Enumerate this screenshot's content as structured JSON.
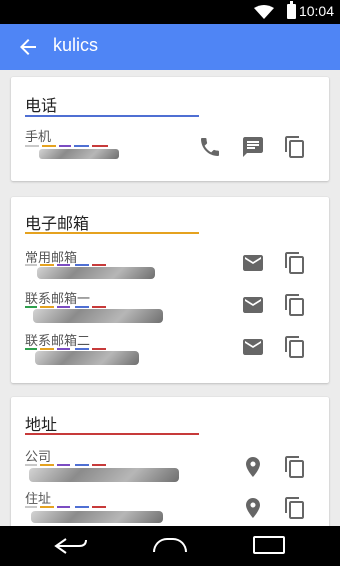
{
  "status_bar": {
    "time": "10:04"
  },
  "app_bar": {
    "title": "kulics",
    "back_icon": "arrow-back-icon"
  },
  "sections": {
    "phone": {
      "title": "电话",
      "underline_color": "#4f6fd3",
      "items": [
        {
          "label": "手机"
        }
      ]
    },
    "email": {
      "title": "电子邮箱",
      "underline_color": "#e5a21f",
      "items": [
        {
          "label": "常用邮箱"
        },
        {
          "label": "联系邮箱一"
        },
        {
          "label": "联系邮箱二"
        }
      ]
    },
    "address": {
      "title": "地址",
      "underline_color": "#c73a3a",
      "items": [
        {
          "label": "公司"
        },
        {
          "label": "住址"
        }
      ]
    }
  },
  "icons": {
    "call": "phone-icon",
    "message": "message-icon",
    "copy": "copy-icon",
    "email": "email-icon",
    "location": "location-icon"
  },
  "colors": {
    "app_bar": "#4f85f5",
    "accent_blue": "#4f6fd3",
    "accent_yellow": "#e5a21f",
    "accent_red": "#c73a3a",
    "accent_green": "#2e9f4c",
    "accent_purple": "#7b4cc2"
  }
}
